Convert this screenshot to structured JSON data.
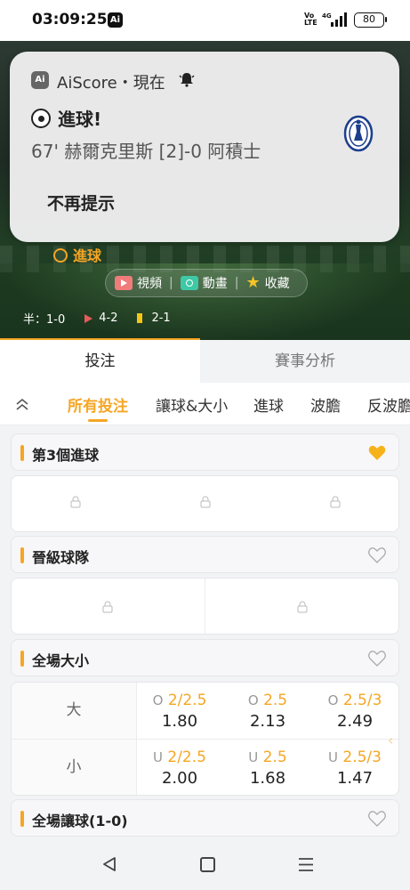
{
  "status_bar": {
    "time": "03:09:25",
    "app_badge": "Ai",
    "volte_top": "Vo",
    "volte_bottom": "LTE",
    "network": "4G",
    "battery": "80"
  },
  "notification": {
    "app_icon": "Ai",
    "app_line": "AiScore・現在",
    "title": "進球!",
    "body": "67' 赫爾克里斯 [2]-0 阿積士",
    "action": "不再提示"
  },
  "hero": {
    "goal_tag": "進球",
    "media": [
      "視頻",
      "動畫",
      "收藏"
    ],
    "halftime": "半：1-0",
    "corners": "4-2",
    "yellow_cards": "2-1",
    "accent": "#f5a623"
  },
  "tabs": [
    "投注",
    "賽事分析"
  ],
  "filters": [
    "所有投注",
    "讓球&大小",
    "進球",
    "波膽",
    "反波膽"
  ],
  "sections": {
    "third_goal": "第3個進球",
    "advance": "晉級球隊",
    "total_ou": "全場大小",
    "handicap": "全場讓球(1-0)"
  },
  "over_under": {
    "over_label": "大",
    "under_label": "小",
    "over": [
      {
        "side": "O",
        "line": "2/2.5",
        "odds": "1.80"
      },
      {
        "side": "O",
        "line": "2.5",
        "odds": "2.13"
      },
      {
        "side": "O",
        "line": "2.5/3",
        "odds": "2.49"
      }
    ],
    "under": [
      {
        "side": "U",
        "line": "2/2.5",
        "odds": "2.00"
      },
      {
        "side": "U",
        "line": "2.5",
        "odds": "1.68"
      },
      {
        "side": "U",
        "line": "2.5/3",
        "odds": "1.47"
      }
    ]
  },
  "icons": {
    "bell": "bell-icon",
    "heart": "heart-icon",
    "lock": "lock-icon",
    "back": "back-icon",
    "home": "home-icon",
    "menu": "menu-icon"
  }
}
